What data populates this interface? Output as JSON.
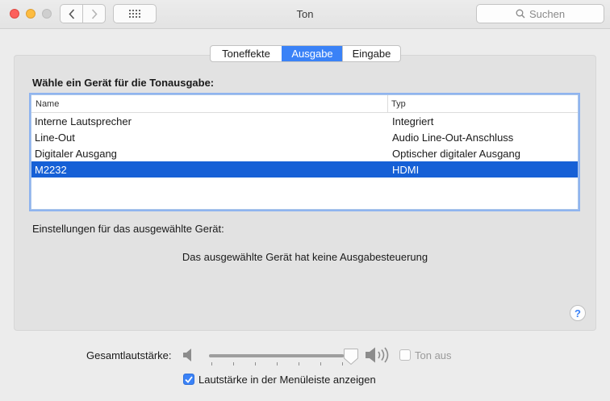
{
  "window": {
    "title": "Ton"
  },
  "search": {
    "placeholder": "Suchen"
  },
  "tabs": [
    {
      "label": "Toneffekte",
      "active": false
    },
    {
      "label": "Ausgabe",
      "active": true
    },
    {
      "label": "Eingabe",
      "active": false
    }
  ],
  "output": {
    "heading": "Wähle ein Gerät für die Tonausgabe:",
    "columns": {
      "name": "Name",
      "type": "Typ"
    },
    "devices": [
      {
        "name": "Interne Lautsprecher",
        "type": "Integriert",
        "selected": false
      },
      {
        "name": "Line-Out",
        "type": "Audio Line-Out-Anschluss",
        "selected": false
      },
      {
        "name": "Digitaler Ausgang",
        "type": "Optischer digitaler Ausgang",
        "selected": false
      },
      {
        "name": "M2232",
        "type": "HDMI",
        "selected": true
      }
    ],
    "settings_label": "Einstellungen für das ausgewählte Gerät:",
    "no_control_message": "Das ausgewählte Gerät hat keine Ausgabesteuerung"
  },
  "help": {
    "symbol": "?"
  },
  "volume": {
    "label": "Gesamtlautstärke:",
    "level": 0.94,
    "mute_label": "Ton aus",
    "mute_checked": false
  },
  "menu_bar": {
    "label": "Lautstärke in der Menüleiste anzeigen",
    "checked": true
  },
  "colors": {
    "accent": "#3a82f7",
    "selection": "#1660d6"
  }
}
